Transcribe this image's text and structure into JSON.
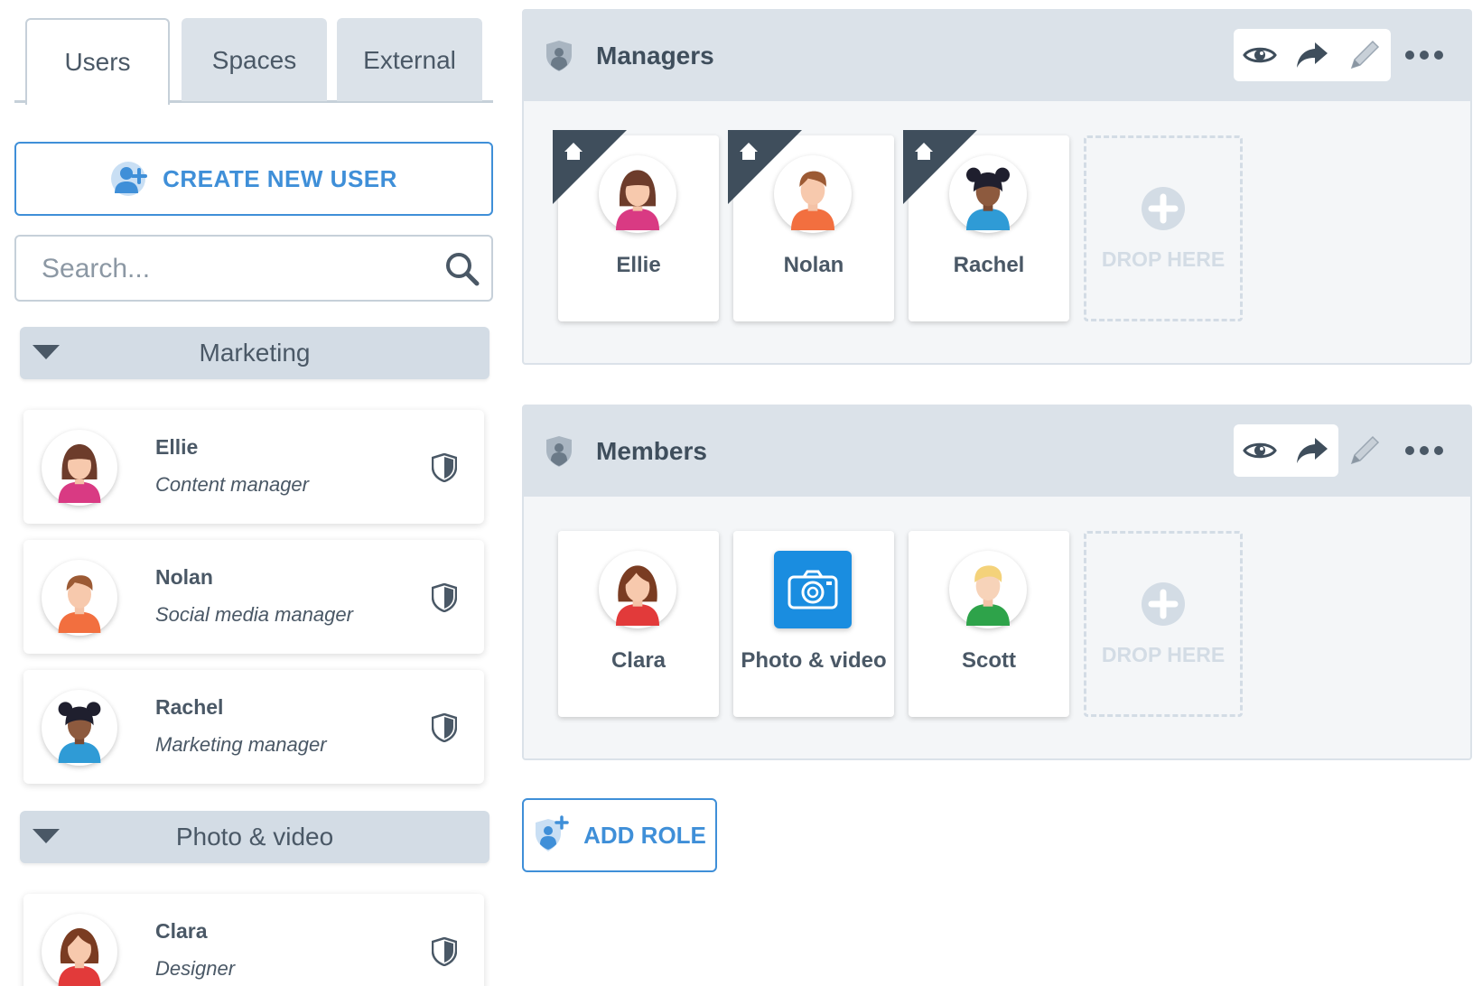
{
  "tabs": [
    {
      "label": "Users",
      "active": true
    },
    {
      "label": "Spaces",
      "active": false
    },
    {
      "label": "External",
      "active": false
    }
  ],
  "sidebar": {
    "create_user_label": "CREATE NEW USER",
    "search_placeholder": "Search...",
    "groups": [
      {
        "label": "Marketing",
        "users": [
          {
            "name": "Ellie",
            "role": "Content manager",
            "avatar": "female-brown-hair"
          },
          {
            "name": "Nolan",
            "role": "Social media manager",
            "avatar": "male-orange-shirt"
          },
          {
            "name": "Rachel",
            "role": "Marketing manager",
            "avatar": "female-dark-hair-buns"
          }
        ]
      },
      {
        "label": "Photo & video",
        "users": [
          {
            "name": "Clara",
            "role": "Designer",
            "avatar": "female-red-shirt"
          }
        ]
      }
    ]
  },
  "roles": [
    {
      "title": "Managers",
      "members": [
        {
          "name": "Ellie",
          "home": true
        },
        {
          "name": "Nolan",
          "home": true
        },
        {
          "name": "Rachel",
          "home": true
        }
      ],
      "drop_label": "DROP HERE"
    },
    {
      "title": "Members",
      "members": [
        {
          "name": "Clara",
          "home": false
        },
        {
          "name": "Photo & video",
          "home": false
        },
        {
          "name": "Scott",
          "home": false
        }
      ],
      "drop_label": "DROP HERE"
    }
  ],
  "add_role_label": "ADD ROLE",
  "colors": {
    "accent": "#3f8fd8",
    "header_bg": "#dbe2e9",
    "text": "#4a5866",
    "camera_tile": "#1a8de0"
  }
}
